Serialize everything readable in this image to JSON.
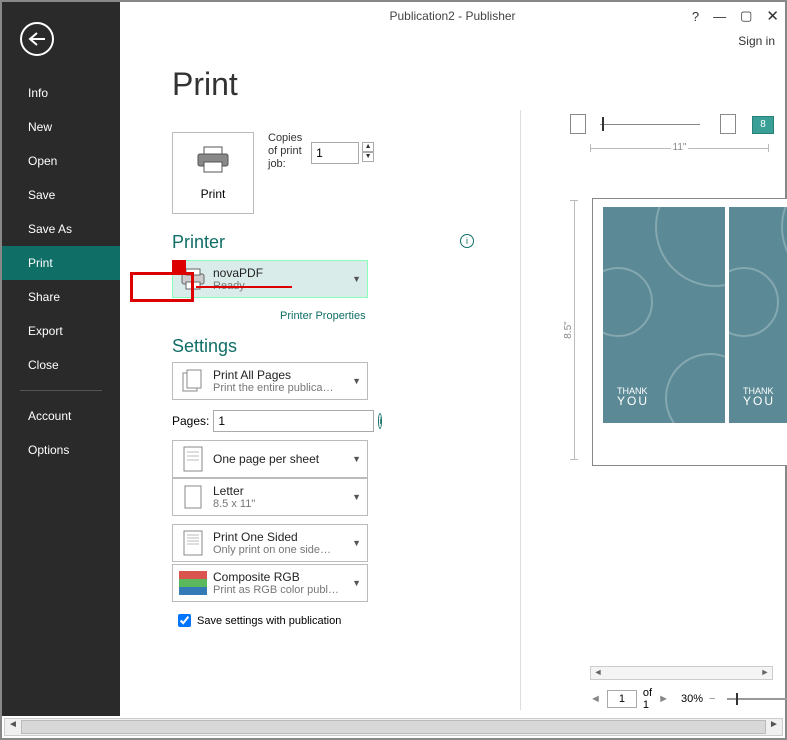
{
  "window": {
    "title": "Publication2 - Publisher",
    "signin": "Sign in"
  },
  "sidebar": {
    "items": [
      "Info",
      "New",
      "Open",
      "Save",
      "Save As",
      "Print",
      "Share",
      "Export",
      "Close"
    ],
    "secondary": [
      "Account",
      "Options"
    ],
    "active": "Print"
  },
  "page": {
    "heading": "Print"
  },
  "print_button": {
    "label": "Print"
  },
  "copies": {
    "label": "Copies of print job:",
    "value": "1"
  },
  "printer": {
    "heading": "Printer",
    "name": "novaPDF",
    "status": "Ready",
    "properties_link": "Printer Properties"
  },
  "settings": {
    "heading": "Settings",
    "print_all": {
      "title": "Print All Pages",
      "sub": "Print the entire publica…"
    },
    "pages_label": "Pages:",
    "pages_value": "1",
    "one_per_sheet": {
      "title": "One page per sheet",
      "sub": ""
    },
    "paper": {
      "title": "Letter",
      "sub": "8.5 x 11\""
    },
    "one_sided": {
      "title": "Print One Sided",
      "sub": "Only print on one side…"
    },
    "composite": {
      "title": "Composite RGB",
      "sub": "Print as RGB color publ…"
    },
    "save_checkbox": "Save settings with publication",
    "save_checked": true
  },
  "preview": {
    "ruler_width": "11\"",
    "ruler_height": "8.5\"",
    "eight_badge": "8",
    "card_text_top": "THANK",
    "card_text_bottom": "YOU",
    "nav_page": "1",
    "nav_total": "of 1",
    "zoom": "30%"
  }
}
